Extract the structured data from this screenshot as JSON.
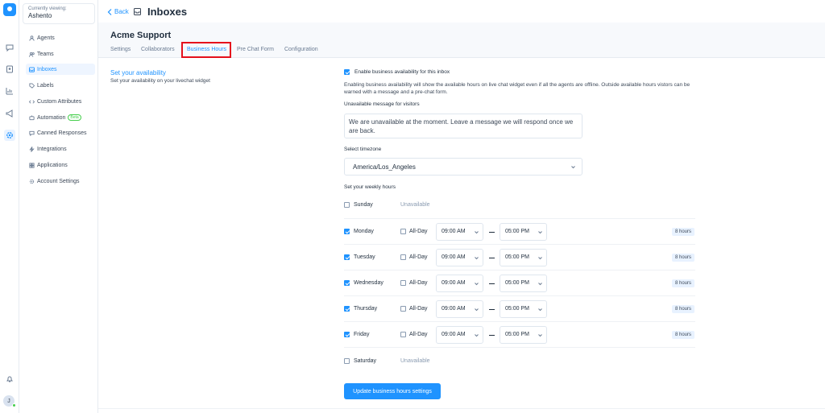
{
  "account": {
    "label": "Currently viewing:",
    "name": "Ashento"
  },
  "header": {
    "back_label": "Back",
    "title": "Inboxes"
  },
  "sidebar": {
    "items": [
      {
        "label": "Agents",
        "icon": "person-icon"
      },
      {
        "label": "Teams",
        "icon": "people-icon"
      },
      {
        "label": "Inboxes",
        "icon": "inbox-icon",
        "active": true
      },
      {
        "label": "Labels",
        "icon": "tag-icon"
      },
      {
        "label": "Custom Attributes",
        "icon": "code-icon"
      },
      {
        "label": "Automation",
        "icon": "automation-icon",
        "badge": "Beta"
      },
      {
        "label": "Canned Responses",
        "icon": "chat-icon"
      },
      {
        "label": "Integrations",
        "icon": "flash-icon"
      },
      {
        "label": "Applications",
        "icon": "apps-icon"
      },
      {
        "label": "Account Settings",
        "icon": "gear-icon"
      }
    ]
  },
  "inbox": {
    "name": "Acme Support",
    "tabs": [
      "Settings",
      "Collaborators",
      "Business Hours",
      "Pre Chat Form",
      "Configuration"
    ],
    "active_tab": "Business Hours"
  },
  "availability": {
    "title": "Set your availability",
    "description": "Set your availability on your livechat widget",
    "enable_label": "Enable business availability for this inbox",
    "enable_checked": true,
    "enable_help": "Enabling business availability will show the available hours on live chat widget even if all the agents are offline. Outside available hours vistors can be warned with a message and a pre-chat form.",
    "message_label": "Unavailable message for visitors",
    "message_value": "We are unavailable at the moment. Leave a message we will respond once we are back.",
    "timezone_label": "Select timezone",
    "timezone_value": "America/Los_Angeles",
    "weekly_label": "Set your weekly hours",
    "all_day_label": "All-Day",
    "unavailable_label": "Unavailable",
    "days": [
      {
        "name": "Sunday",
        "enabled": false
      },
      {
        "name": "Monday",
        "enabled": true,
        "from": "09:00 AM",
        "to": "05:00 PM",
        "hours": "8 hours"
      },
      {
        "name": "Tuesday",
        "enabled": true,
        "from": "09:00 AM",
        "to": "05:00 PM",
        "hours": "8 hours"
      },
      {
        "name": "Wednesday",
        "enabled": true,
        "from": "09:00 AM",
        "to": "05:00 PM",
        "hours": "8 hours"
      },
      {
        "name": "Thursday",
        "enabled": true,
        "from": "09:00 AM",
        "to": "05:00 PM",
        "hours": "8 hours"
      },
      {
        "name": "Friday",
        "enabled": true,
        "from": "09:00 AM",
        "to": "05:00 PM",
        "hours": "8 hours"
      },
      {
        "name": "Saturday",
        "enabled": false
      }
    ],
    "update_button": "Update business hours settings"
  },
  "colors": {
    "accent": "#1f93ff",
    "highlight": "#e5101c",
    "beta": "#44ce4b"
  },
  "user": {
    "initial": "J"
  }
}
